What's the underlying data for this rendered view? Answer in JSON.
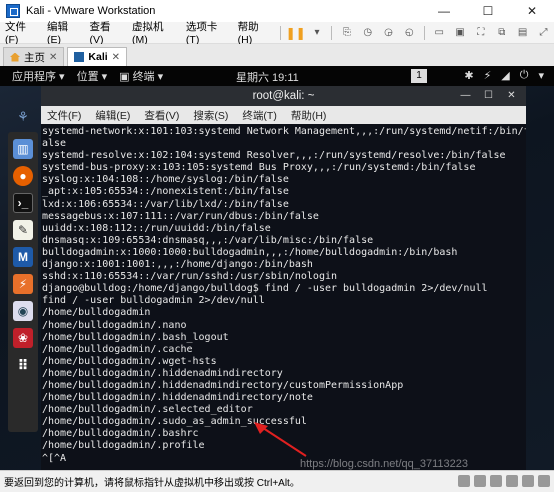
{
  "window": {
    "title": "Kali - VMware Workstation",
    "minimize": "—",
    "maximize": "☐",
    "close": "✕"
  },
  "vm_menu": [
    "文件(F)",
    "编辑(E)",
    "查看(V)",
    "虚拟机(M)",
    "选项卡(T)",
    "帮助(H)"
  ],
  "vm_tabs": [
    {
      "label": "主页"
    },
    {
      "label": "Kali"
    }
  ],
  "gnome": {
    "applications": "应用程序 ▾",
    "places": "位置 ▾",
    "terminal": "终端 ▾",
    "clock": "星期六 19:11",
    "workspace": "1"
  },
  "terminal": {
    "title": "root@kali: ~",
    "menu": [
      "文件(F)",
      "编辑(E)",
      "查看(V)",
      "搜索(S)",
      "终端(T)",
      "帮助(H)"
    ],
    "lines": [
      "systemd-network:x:101:103:systemd Network Management,,,:/run/systemd/netif:/bin/f",
      "alse",
      "systemd-resolve:x:102:104:systemd Resolver,,,:/run/systemd/resolve:/bin/false",
      "systemd-bus-proxy:x:103:105:systemd Bus Proxy,,,:/run/systemd:/bin/false",
      "syslog:x:104:108::/home/syslog:/bin/false",
      "_apt:x:105:65534::/nonexistent:/bin/false",
      "lxd:x:106:65534::/var/lib/lxd/:/bin/false",
      "messagebus:x:107:111::/var/run/dbus:/bin/false",
      "uuidd:x:108:112::/run/uuidd:/bin/false",
      "dnsmasq:x:109:65534:dnsmasq,,,:/var/lib/misc:/bin/false",
      "bulldogadmin:x:1000:1000:bulldogadmin,,,:/home/bulldogadmin:/bin/bash",
      "django:x:1001:1001:,,,:/home/django:/bin/bash",
      "sshd:x:110:65534::/var/run/sshd:/usr/sbin/nologin",
      "django@bulldog:/home/django/bulldog$ find / -user bulldogadmin 2>/dev/null",
      "find / -user bulldogadmin 2>/dev/null",
      "/home/bulldogadmin",
      "/home/bulldogadmin/.nano",
      "/home/bulldogadmin/.bash_logout",
      "/home/bulldogadmin/.cache",
      "/home/bulldogadmin/.wget-hsts",
      "/home/bulldogadmin/.hiddenadmindirectory",
      "/home/bulldogadmin/.hiddenadmindirectory/customPermissionApp",
      "/home/bulldogadmin/.hiddenadmindirectory/note",
      "/home/bulldogadmin/.selected_editor",
      "/home/bulldogadmin/.sudo_as_admin_successful",
      "/home/bulldogadmin/.bashrc",
      "/home/bulldogadmin/.profile",
      "^[^A"
    ]
  },
  "watermark": "https://blog.csdn.net/qq_37113223",
  "status_bar": "要返回到您的计算机，请将鼠标指针从虚拟机中移出或按 Ctrl+Alt。",
  "icons": [
    "kali-dragon-icon",
    "files-icon",
    "firefox-icon",
    "terminal-icon",
    "text-editor-icon",
    "metasploit-icon",
    "burpsuite-icon",
    "eye-icon",
    "cherrytree-icon",
    "app-grid-icon"
  ]
}
